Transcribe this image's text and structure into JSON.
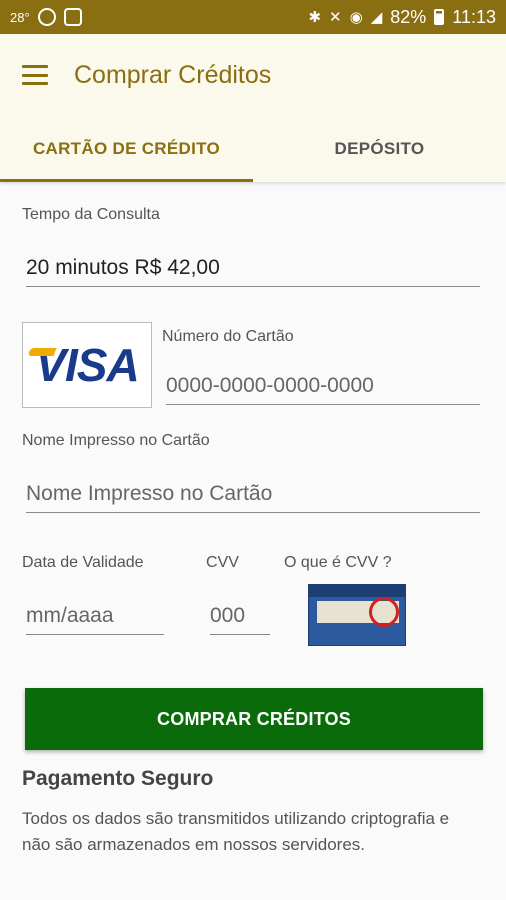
{
  "status_bar": {
    "temperature": "28°",
    "battery_percent": "82%",
    "time": "11:13"
  },
  "app_bar": {
    "title": "Comprar Créditos",
    "menu_icon": "hamburger-menu-icon"
  },
  "tabs": [
    {
      "label": "CARTÃO DE CRÉDITO",
      "active": true
    },
    {
      "label": "DEPÓSITO",
      "active": false
    }
  ],
  "form": {
    "consultation_time": {
      "label": "Tempo da Consulta",
      "value": "20 minutos R$ 42,00"
    },
    "card_number": {
      "label": "Número do Cartão",
      "placeholder": "0000-0000-0000-0000"
    },
    "card_brand": "VISA",
    "card_name": {
      "label": "Nome Impresso no Cartão",
      "placeholder": "Nome Impresso no Cartão"
    },
    "expiry": {
      "label": "Data de Validade",
      "placeholder": "mm/aaaa"
    },
    "cvv": {
      "label": "CVV",
      "placeholder": "000"
    },
    "cvv_help": {
      "label": "O que é CVV ?"
    }
  },
  "buy_button": {
    "label": "COMPRAR CRÉDITOS"
  },
  "secure_payment": {
    "title": "Pagamento Seguro",
    "text": "Todos os dados são transmitidos utilizando criptografia e não são armazenados em nossos servidores."
  },
  "colors": {
    "primary": "#8a6f12",
    "button": "#0a6b0a",
    "visa_blue": "#1a3a8c"
  }
}
